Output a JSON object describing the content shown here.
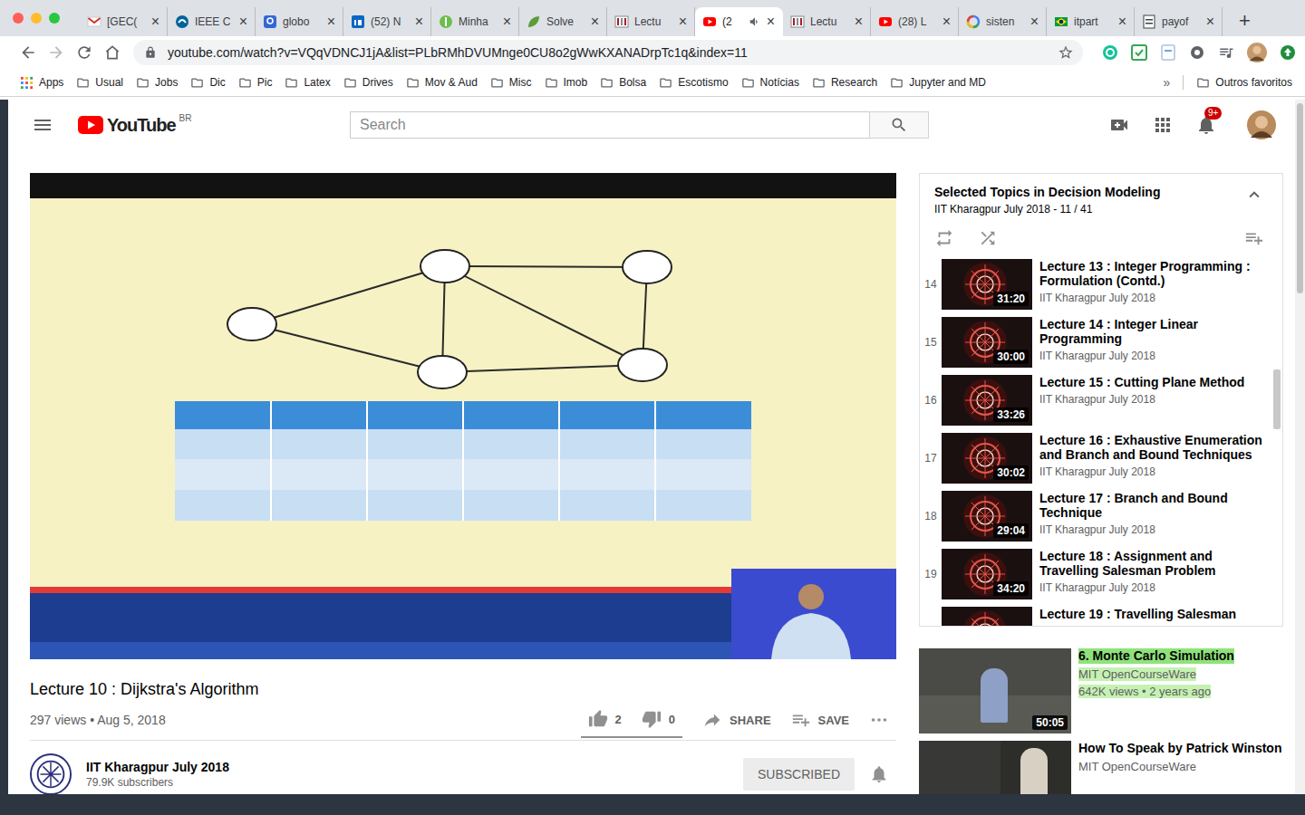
{
  "browser": {
    "tabs": [
      {
        "label": "[GEC(",
        "icon": "gmail",
        "selected": false,
        "audio": false
      },
      {
        "label": "IEEE C",
        "icon": "ieee",
        "selected": false,
        "audio": false
      },
      {
        "label": "globo",
        "icon": "gdocs",
        "selected": false,
        "audio": false
      },
      {
        "label": "(52) N",
        "icon": "linkedin",
        "selected": false,
        "audio": false
      },
      {
        "label": "Minha",
        "icon": "dollar",
        "selected": false,
        "audio": false
      },
      {
        "label": "Solve",
        "icon": "leaf",
        "selected": false,
        "audio": false
      },
      {
        "label": "Lectu",
        "icon": "mit",
        "selected": false,
        "audio": false
      },
      {
        "label": "(2",
        "icon": "youtube",
        "selected": true,
        "audio": true
      },
      {
        "label": "Lectu",
        "icon": "mit",
        "selected": false,
        "audio": false
      },
      {
        "label": "(28) L",
        "icon": "youtube",
        "selected": false,
        "audio": false
      },
      {
        "label": "sisten",
        "icon": "google",
        "selected": false,
        "audio": false
      },
      {
        "label": "itpart",
        "icon": "brazil",
        "selected": false,
        "audio": false
      },
      {
        "label": "payof",
        "icon": "doc",
        "selected": false,
        "audio": false
      }
    ],
    "tab_close": "×",
    "new_tab": "+",
    "address": "youtube.com/watch?v=VQqVDNCJ1jA&list=PLbRMhDVUMnge0CU8o2gWwKXANADrpTc1q&index=11",
    "bookmarks": [
      {
        "label": "Apps",
        "kind": "apps"
      },
      {
        "label": "Usual",
        "kind": "folder"
      },
      {
        "label": "Jobs",
        "kind": "folder"
      },
      {
        "label": "Dic",
        "kind": "folder"
      },
      {
        "label": "Pic",
        "kind": "folder"
      },
      {
        "label": "Latex",
        "kind": "folder"
      },
      {
        "label": "Drives",
        "kind": "folder"
      },
      {
        "label": "Mov & Aud",
        "kind": "folder"
      },
      {
        "label": "Misc",
        "kind": "folder"
      },
      {
        "label": "Imob",
        "kind": "folder"
      },
      {
        "label": "Bolsa",
        "kind": "folder"
      },
      {
        "label": "Escotismo",
        "kind": "folder"
      },
      {
        "label": "Notícias",
        "kind": "folder"
      },
      {
        "label": "Research",
        "kind": "folder"
      },
      {
        "label": "Jupyter and MD",
        "kind": "folder"
      }
    ],
    "bookmarks_more": "»",
    "other_bookmarks": "Outros favoritos"
  },
  "youtube": {
    "logo": "YouTube",
    "region": "BR",
    "search_placeholder": "Search",
    "notifications": "9+"
  },
  "video": {
    "title": "Lecture 10 : Dijkstra's Algorithm",
    "meta": "297 views • Aug 5, 2018",
    "likes": "2",
    "dislikes": "0",
    "share": "SHARE",
    "save": "SAVE"
  },
  "channel": {
    "name": "IIT Kharagpur July 2018",
    "subscribers": "79.9K subscribers",
    "button": "SUBSCRIBED"
  },
  "playlist": {
    "title": "Selected Topics in Decision Modeling",
    "subtitle": "IIT Kharagpur July 2018 - 11 / 41",
    "items": [
      {
        "index": "14",
        "title": "Lecture 13 : Integer Programming : Formulation (Contd.)",
        "channel": "IIT Kharagpur July 2018",
        "duration": "31:20"
      },
      {
        "index": "15",
        "title": "Lecture 14 : Integer Linear Programming",
        "channel": "IIT Kharagpur July 2018",
        "duration": "30:00"
      },
      {
        "index": "16",
        "title": "Lecture 15 : Cutting Plane Method",
        "channel": "IIT Kharagpur July 2018",
        "duration": "33:26"
      },
      {
        "index": "17",
        "title": "Lecture 16 : Exhaustive Enumeration and Branch and Bound Techniques",
        "channel": "IIT Kharagpur July 2018",
        "duration": "30:02"
      },
      {
        "index": "18",
        "title": "Lecture 17 : Branch and Bound Technique",
        "channel": "IIT Kharagpur July 2018",
        "duration": "29:04"
      },
      {
        "index": "19",
        "title": "Lecture 18 : Assignment and Travelling Salesman Problem",
        "channel": "IIT Kharagpur July 2018",
        "duration": "34:20"
      },
      {
        "title": "Lecture 19 : Travelling Salesman"
      }
    ]
  },
  "recommendations": [
    {
      "title": "6. Monte Carlo Simulation",
      "channel": "MIT OpenCourseWare",
      "meta": "642K views • 2 years ago",
      "duration": "50:05",
      "highlighted": true
    },
    {
      "title": "How To Speak by Patrick Winston",
      "channel": "MIT OpenCourseWare",
      "highlighted": false
    }
  ]
}
